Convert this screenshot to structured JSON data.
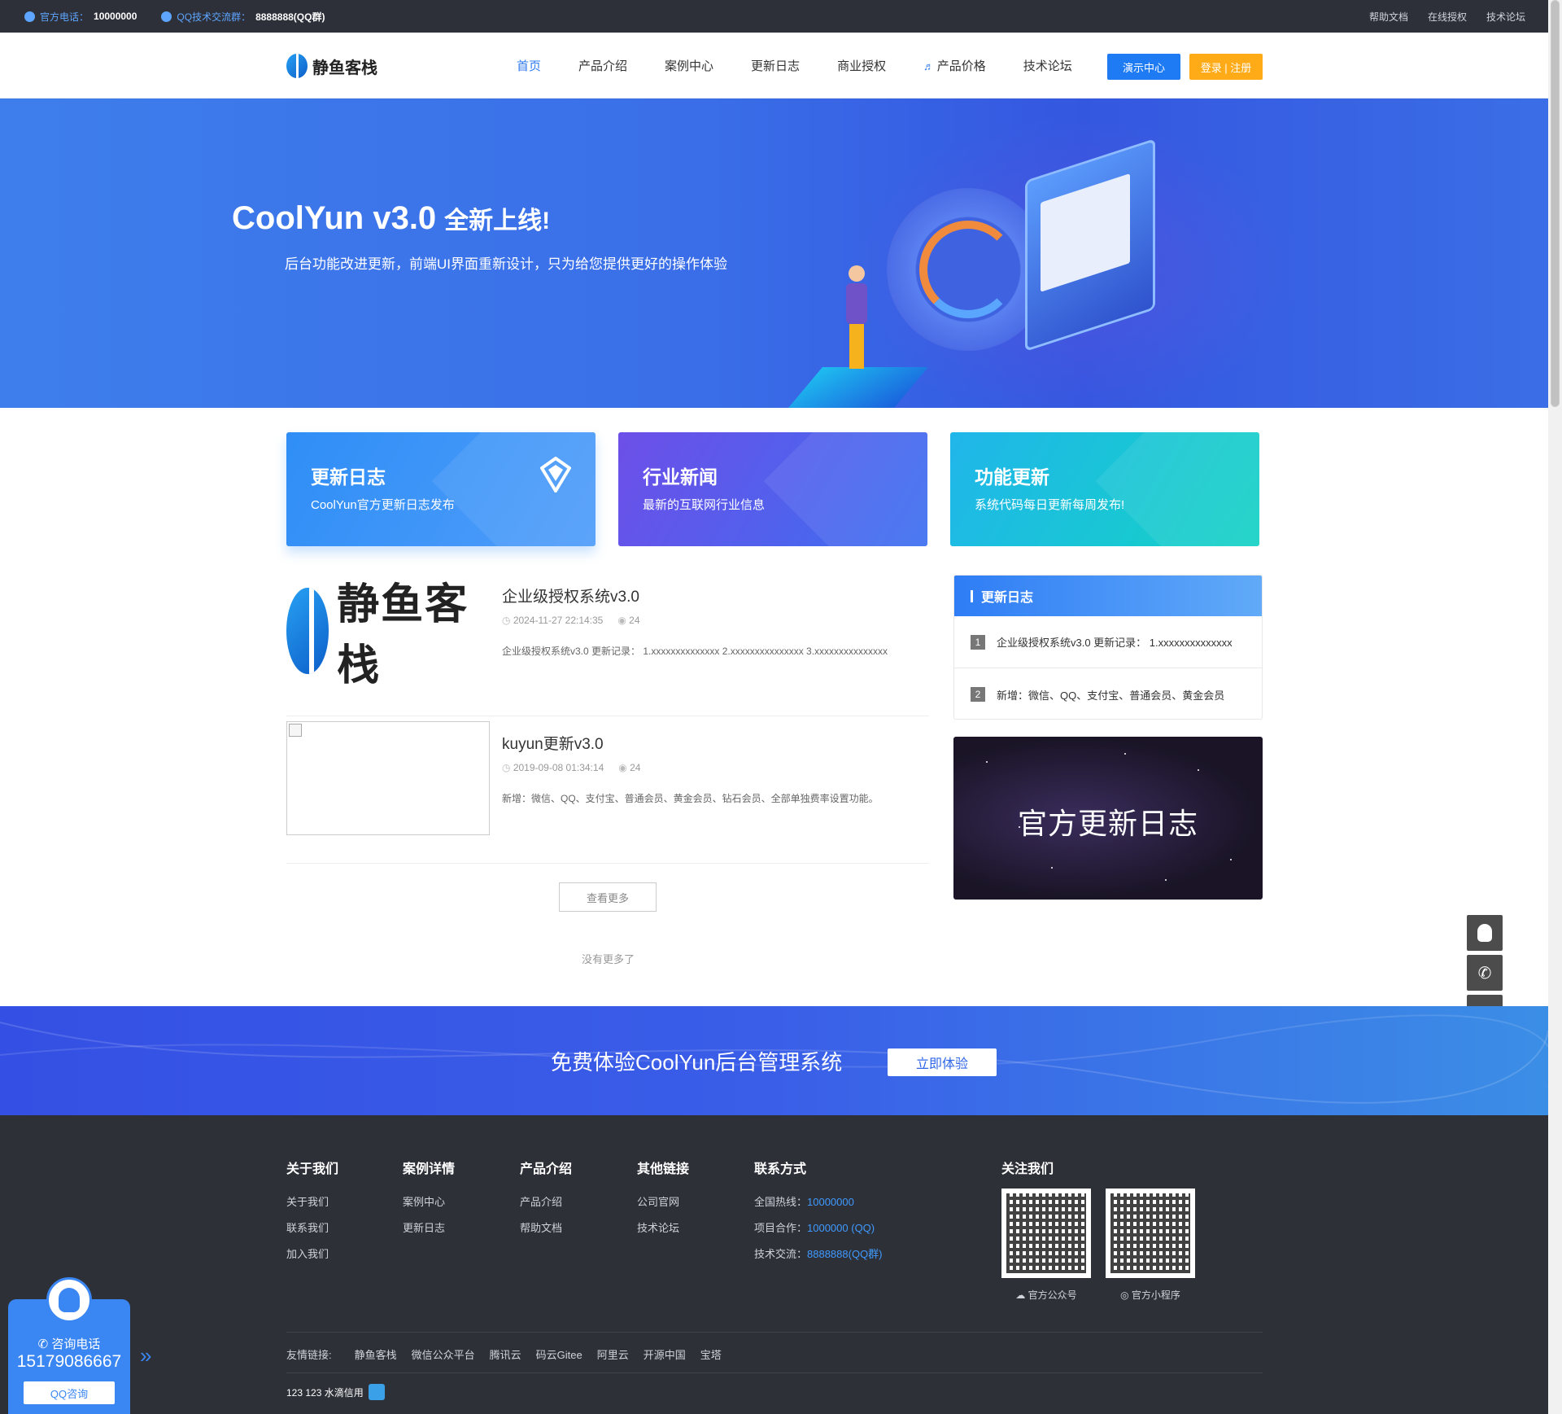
{
  "topbar": {
    "phone_label": "官方电话：",
    "phone_value": "10000000",
    "qq_label": "QQ技术交流群：",
    "qq_value": "8888888(QQ群)",
    "links": [
      "帮助文档",
      "在线授权",
      "技术论坛"
    ]
  },
  "header": {
    "logo_text": "静鱼客栈",
    "nav": [
      "首页",
      "产品介绍",
      "案例中心",
      "更新日志",
      "商业授权",
      "产品价格",
      "技术论坛"
    ],
    "demo_button": "演示中心",
    "login_button": "登录 | 注册"
  },
  "banner": {
    "title": "CoolYun v3.0",
    "title_suffix": "全新上线!",
    "subtitle": "后台功能改进更新，前端UI界面重新设计，只为给您提供更好的操作体验"
  },
  "cards": [
    {
      "title": "更新日志",
      "desc": "CoolYun官方更新日志发布"
    },
    {
      "title": "行业新闻",
      "desc": "最新的互联网行业信息"
    },
    {
      "title": "功能更新",
      "desc": "系统代码每日更新每周发布!"
    }
  ],
  "articles": [
    {
      "thumb_text": "静鱼客栈",
      "title": "企业级授权系统v3.0",
      "date": "2024-11-27 22:14:35",
      "views": "24",
      "excerpt": "企业级授权系统v3.0 更新记录： 1.xxxxxxxxxxxxxx 2.xxxxxxxxxxxxxxx 3.xxxxxxxxxxxxxxx"
    },
    {
      "title": "kuyun更新v3.0",
      "date": "2019-09-08 01:34:14",
      "views": "24",
      "excerpt": "新增：微信、QQ、支付宝、普通会员、黄金会员、钻石会员、全部单独费率设置功能。"
    }
  ],
  "more_button": "查看更多",
  "no_more_text": "没有更多了",
  "sidebar": {
    "title": "更新日志",
    "items": [
      {
        "num": "1",
        "text": "企业级授权系统v3.0 更新记录： 1.xxxxxxxxxxxxxx"
      },
      {
        "num": "2",
        "text": "新增：微信、QQ、支付宝、普通会员、黄金会员"
      }
    ],
    "banner_text": "官方更新日志"
  },
  "cta": {
    "text": "免费体验CoolYun后台管理系统",
    "button": "立即体验"
  },
  "footer": {
    "columns": [
      {
        "title": "关于我们",
        "links": [
          "关于我们",
          "联系我们",
          "加入我们"
        ]
      },
      {
        "title": "案例详情",
        "links": [
          "案例中心",
          "更新日志"
        ]
      },
      {
        "title": "产品介绍",
        "links": [
          "产品介绍",
          "帮助文档"
        ]
      },
      {
        "title": "其他链接",
        "links": [
          "公司官网",
          "技术论坛"
        ]
      }
    ],
    "contact": {
      "title": "联系方式",
      "rows": [
        {
          "label": "全国热线：",
          "value": "10000000"
        },
        {
          "label": "项目合作：",
          "value": "1000000 (QQ)"
        },
        {
          "label": "技术交流：",
          "value": "8888888(QQ群)"
        }
      ]
    },
    "follow": {
      "title": "关注我们",
      "qr1_caption": "官方公众号",
      "qr2_caption": "官方小程序"
    },
    "friend_links_label": "友情链接:",
    "friend_links": [
      "静鱼客栈",
      "微信公众平台",
      "腾讯云",
      "码云Gitee",
      "阿里云",
      "开源中国",
      "宝塔"
    ],
    "copyright": "123 123 水滴信用"
  },
  "consult": {
    "label": "咨询电话",
    "phone": "15179086667",
    "button": "QQ咨询"
  }
}
